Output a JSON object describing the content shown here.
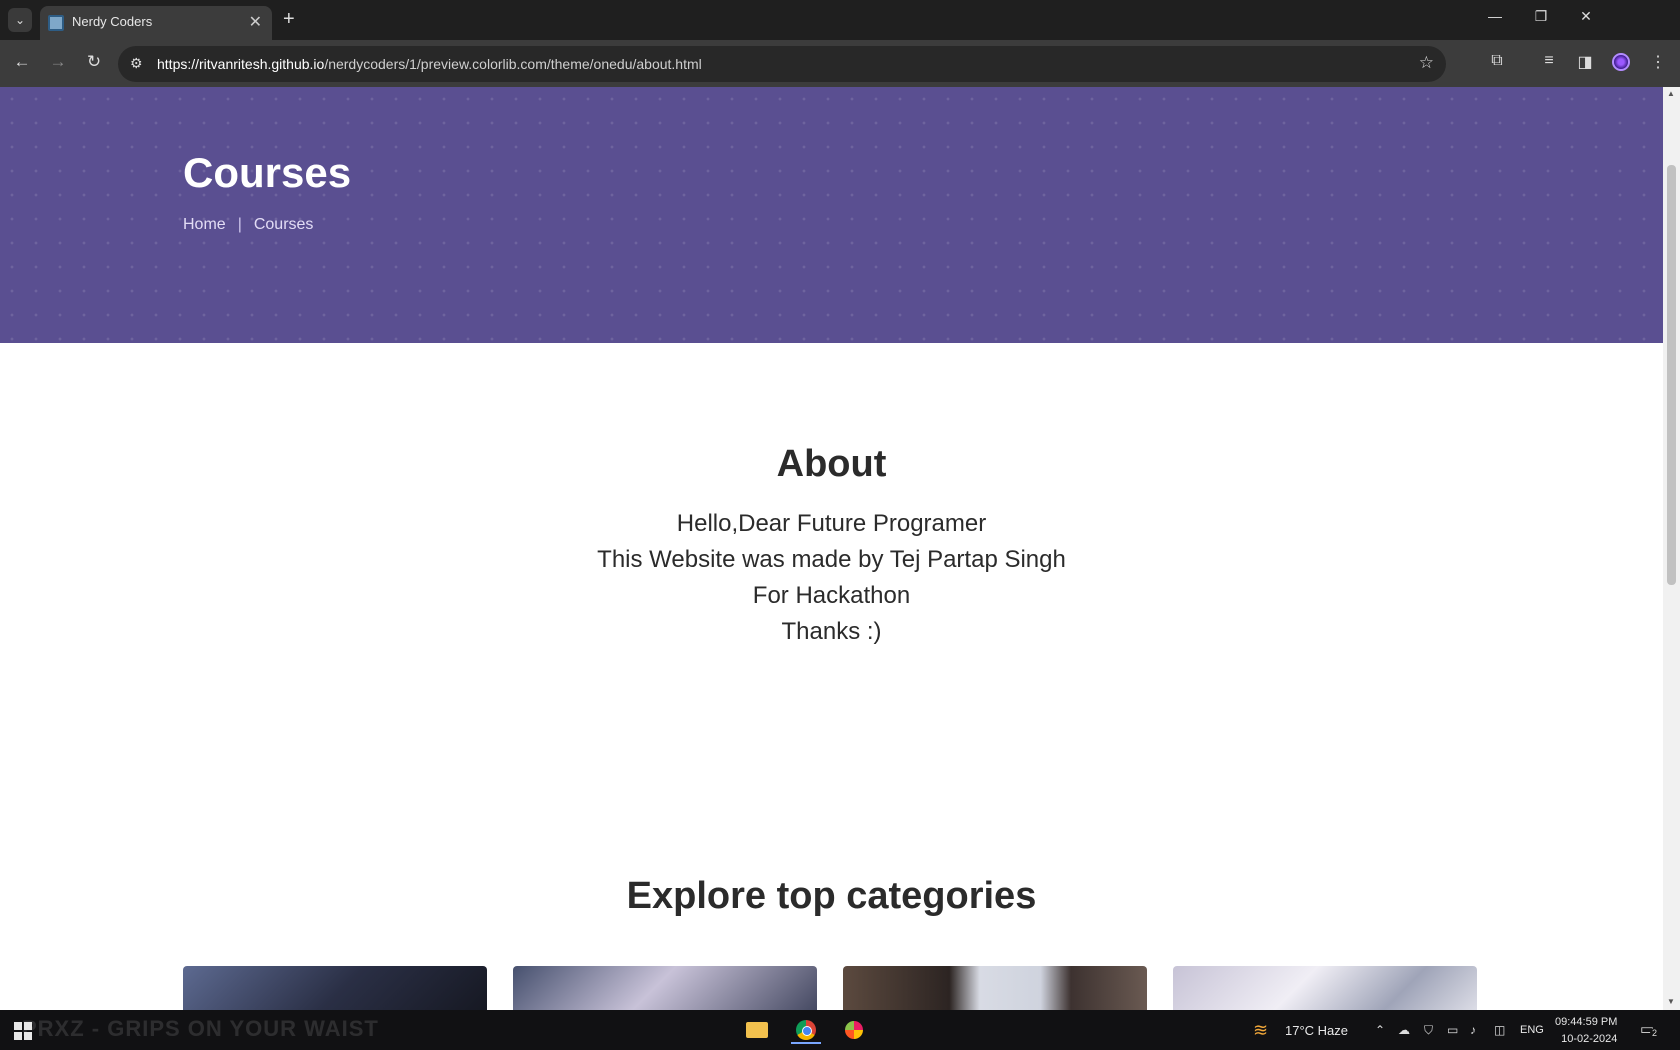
{
  "browser": {
    "tab_title": "Nerdy Coders",
    "url_host": "https://ritvanritesh.github.io",
    "url_path": "/nerdycoders/1/preview.colorlib.com/theme/onedu/about.html"
  },
  "hero": {
    "title": "Courses",
    "breadcrumb": [
      "Home",
      "Courses"
    ],
    "background_color": "#5a4f91"
  },
  "about": {
    "heading": "About",
    "lines": [
      "Hello,Dear Future Programer",
      "This Website was made by Tej Partap Singh",
      "For Hackathon",
      "Thanks :)"
    ]
  },
  "explore": {
    "heading": "Explore top categories"
  },
  "taskbar": {
    "media_text": "PRXZ - GRIPS ON YOUR WAIST",
    "weather": "17°C  Haze",
    "language": "ENG",
    "time": "09:44:59 PM",
    "date": "10-02-2024",
    "notification_count": "2"
  }
}
